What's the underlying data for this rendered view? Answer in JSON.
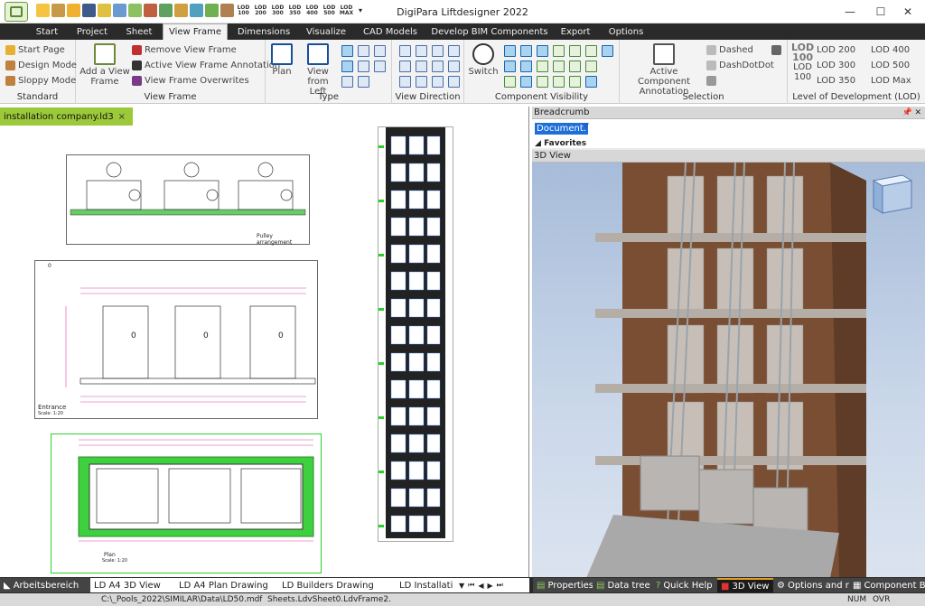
{
  "window": {
    "title": "DigiPara Liftdesigner 2022",
    "minimize": "—",
    "maximize": "☐",
    "close": "✕"
  },
  "qat_lod": [
    [
      "LOD",
      "100"
    ],
    [
      "LOD",
      "200"
    ],
    [
      "LOD",
      "300"
    ],
    [
      "LOD",
      "350"
    ],
    [
      "LOD",
      "400"
    ],
    [
      "LOD",
      "500"
    ],
    [
      "LOD",
      "MAX"
    ]
  ],
  "tabs": [
    "Start",
    "Project",
    "Sheet",
    "View Frame",
    "Dimensions",
    "Visualize",
    "CAD Models",
    "Develop BIM Components",
    "Export",
    "Options"
  ],
  "active_tab": "View Frame",
  "ribbon": {
    "standard": {
      "label": "Standard",
      "items": [
        "Start Page",
        "Design Mode",
        "Sloppy Mode"
      ]
    },
    "view_frame": {
      "label": "View Frame",
      "add": [
        "Add a View",
        "Frame"
      ],
      "items": [
        "Remove View Frame",
        "Active View Frame Annotation",
        "View Frame Overwrites"
      ]
    },
    "type": {
      "label": "Type",
      "plan": "Plan",
      "view_left": [
        "View",
        "from Left"
      ]
    },
    "view_direction": {
      "label": "View Direction"
    },
    "component_visibility": {
      "label": "Component Visibility",
      "switch": "Switch"
    },
    "selection": {
      "label": "Selection",
      "active_annotation": [
        "Active Component",
        "Annotation"
      ],
      "dashed": "Dashed",
      "dashdotdot": "DashDotDot"
    },
    "lod": {
      "label": "Level of Development (LOD)",
      "big": [
        "LOD",
        "100",
        "LOD",
        "100"
      ],
      "items": [
        "LOD 200",
        "LOD 300",
        "LOD 350",
        "LOD 400",
        "LOD 500",
        "LOD Max"
      ]
    }
  },
  "document": {
    "tab": "installation company.ld3",
    "close": "×"
  },
  "drawing": {
    "pulley_label": "Pulley arrangement",
    "entrance_label": "Entrance",
    "entrance_scale": "Scale: 1:20",
    "plan_label": "Plan",
    "plan_scale": "Scale: 1:20",
    "zero": "0",
    "door_marks": [
      "0",
      "0",
      "0"
    ]
  },
  "panels": {
    "breadcrumb": "Breadcrumb",
    "breadcrumb_doc": "Document.",
    "favorites": "Favorites",
    "view3d": "3D View"
  },
  "bottom_tabs": {
    "left": [
      "Arbeitsbereich",
      "LD A4 3D View",
      "LD A4 Plan Drawing",
      "LD Builders Drawing",
      "LD Installati"
    ],
    "right": [
      "Properties",
      "Data tree",
      "Quick Help",
      "3D View",
      "Options and r...",
      "Component Bl..."
    ]
  },
  "status": {
    "path": "C:\\_Pools_2022\\SIMILAR\\Data\\LD50.mdf",
    "sheet": "Sheets.LdvSheet0.LdvFrame2.",
    "num": "NUM",
    "ovr": "OVR"
  }
}
